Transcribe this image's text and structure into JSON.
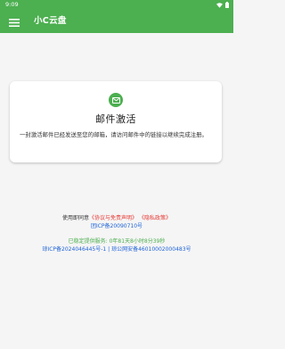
{
  "status_bar": {
    "time": "9:09"
  },
  "app_bar": {
    "title": "小C云盘",
    "menu_icon": "hamburger-menu-icon",
    "color": "#4caf50"
  },
  "card": {
    "icon": "mail-icon",
    "title": "邮件激活",
    "message": "一封激活邮件已经发送至您的邮箱，请访问邮件中的链接以继续完成注册。"
  },
  "footer": {
    "terms_prefix": "使用即同意",
    "terms_link": "《协议与免责声明》",
    "privacy_link": "《隐私政策》",
    "icp_group": "团ICP备20090710号",
    "uptime": "已稳定提供服务: 0年81天8小时8分39秒",
    "icp_main": "琼ICP备2024046445号-1",
    "separator": "|",
    "police_record": "琼公网安备46010002000483号"
  }
}
